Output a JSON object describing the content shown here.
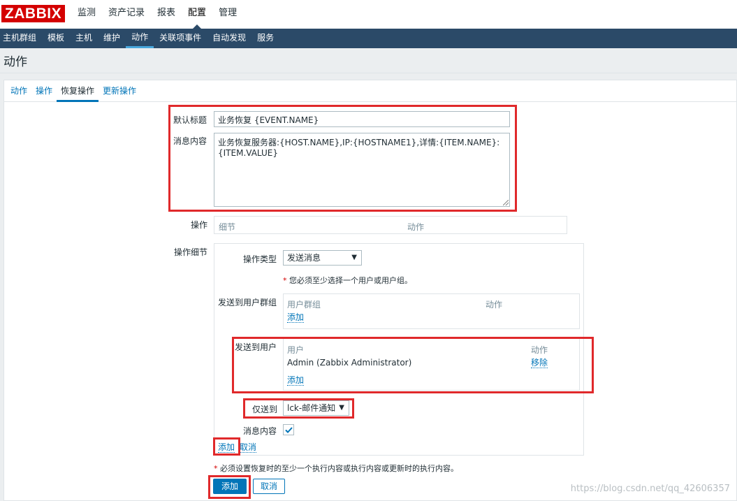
{
  "logo": "ZABBIX",
  "main_menu": [
    "监测",
    "资产记录",
    "报表",
    "配置",
    "管理"
  ],
  "sub_menu": [
    "主机群组",
    "模板",
    "主机",
    "维护",
    "动作",
    "关联项事件",
    "自动发现",
    "服务"
  ],
  "page_title": "动作",
  "tabs": [
    "动作",
    "操作",
    "恢复操作",
    "更新操作"
  ],
  "form": {
    "default_subject_label": "默认标题",
    "default_subject_value": "业务恢复 {EVENT.NAME}",
    "message_label": "消息内容",
    "message_value": "业务恢复服务器:{HOST.NAME},IP:{HOSTNAME1},详情:{ITEM.NAME}:\n{ITEM.VALUE}",
    "operations_label": "操作",
    "operations_columns": [
      "细节",
      "动作"
    ],
    "operation_details_label": "操作细节",
    "operation_type_label": "操作类型",
    "operation_type_value": "发送消息",
    "must_select_note": "您必须至少选择一个用户或用户组。",
    "send_to_groups_label": "发送到用户群组",
    "groups_columns": [
      "用户群组",
      "动作"
    ],
    "groups_add": "添加",
    "send_to_users_label": "发送到用户",
    "users_columns": [
      "用户",
      "动作"
    ],
    "users": [
      {
        "name": "Admin (Zabbix Administrator)",
        "action": "移除"
      }
    ],
    "users_add": "添加",
    "send_only_to_label": "仅送到",
    "send_only_to_value": "lck-邮件通知",
    "message_content_label": "消息内容",
    "message_content_checked": true,
    "detail_add": "添加",
    "detail_cancel": "取消",
    "bottom_note": "必须设置恢复时的至少一个执行内容或执行内容或更新时的执行内容。",
    "add_button": "添加",
    "cancel_button": "取消"
  },
  "watermark": "https://blog.csdn.net/qq_42606357",
  "colors": {
    "brand_red": "#d40000",
    "nav_blue": "#2b4a68",
    "link_blue": "#0275b8",
    "highlight_red": "#e0292b"
  }
}
